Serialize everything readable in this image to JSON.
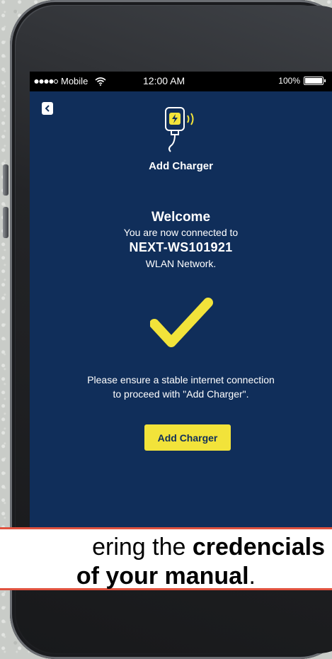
{
  "status_bar": {
    "carrier": "Mobile",
    "time": "12:00 AM",
    "battery": "100%"
  },
  "screen": {
    "title": "Add Charger",
    "welcome": "Welcome",
    "connected_text": "You are now connected to",
    "network_name": "NEXT-WS101921",
    "network_suffix": "WLAN Network.",
    "note_line1": "Please ensure a stable internet connection",
    "note_line2": "to proceed with \"Add Charger\".",
    "button_label": "Add Charger"
  },
  "caption": {
    "line1_prefix": "ering the ",
    "line1_bold": "credencials",
    "line2_bold": "of your manual",
    "line2_suffix": "."
  },
  "colors": {
    "screen_bg": "#102e5a",
    "accent_yellow": "#f2e33a",
    "caption_border": "#e0523f"
  },
  "icons": [
    "back-chevron-icon",
    "charger-wifi-icon",
    "checkmark-icon",
    "wifi-icon",
    "battery-icon",
    "signal-dots-icon"
  ]
}
